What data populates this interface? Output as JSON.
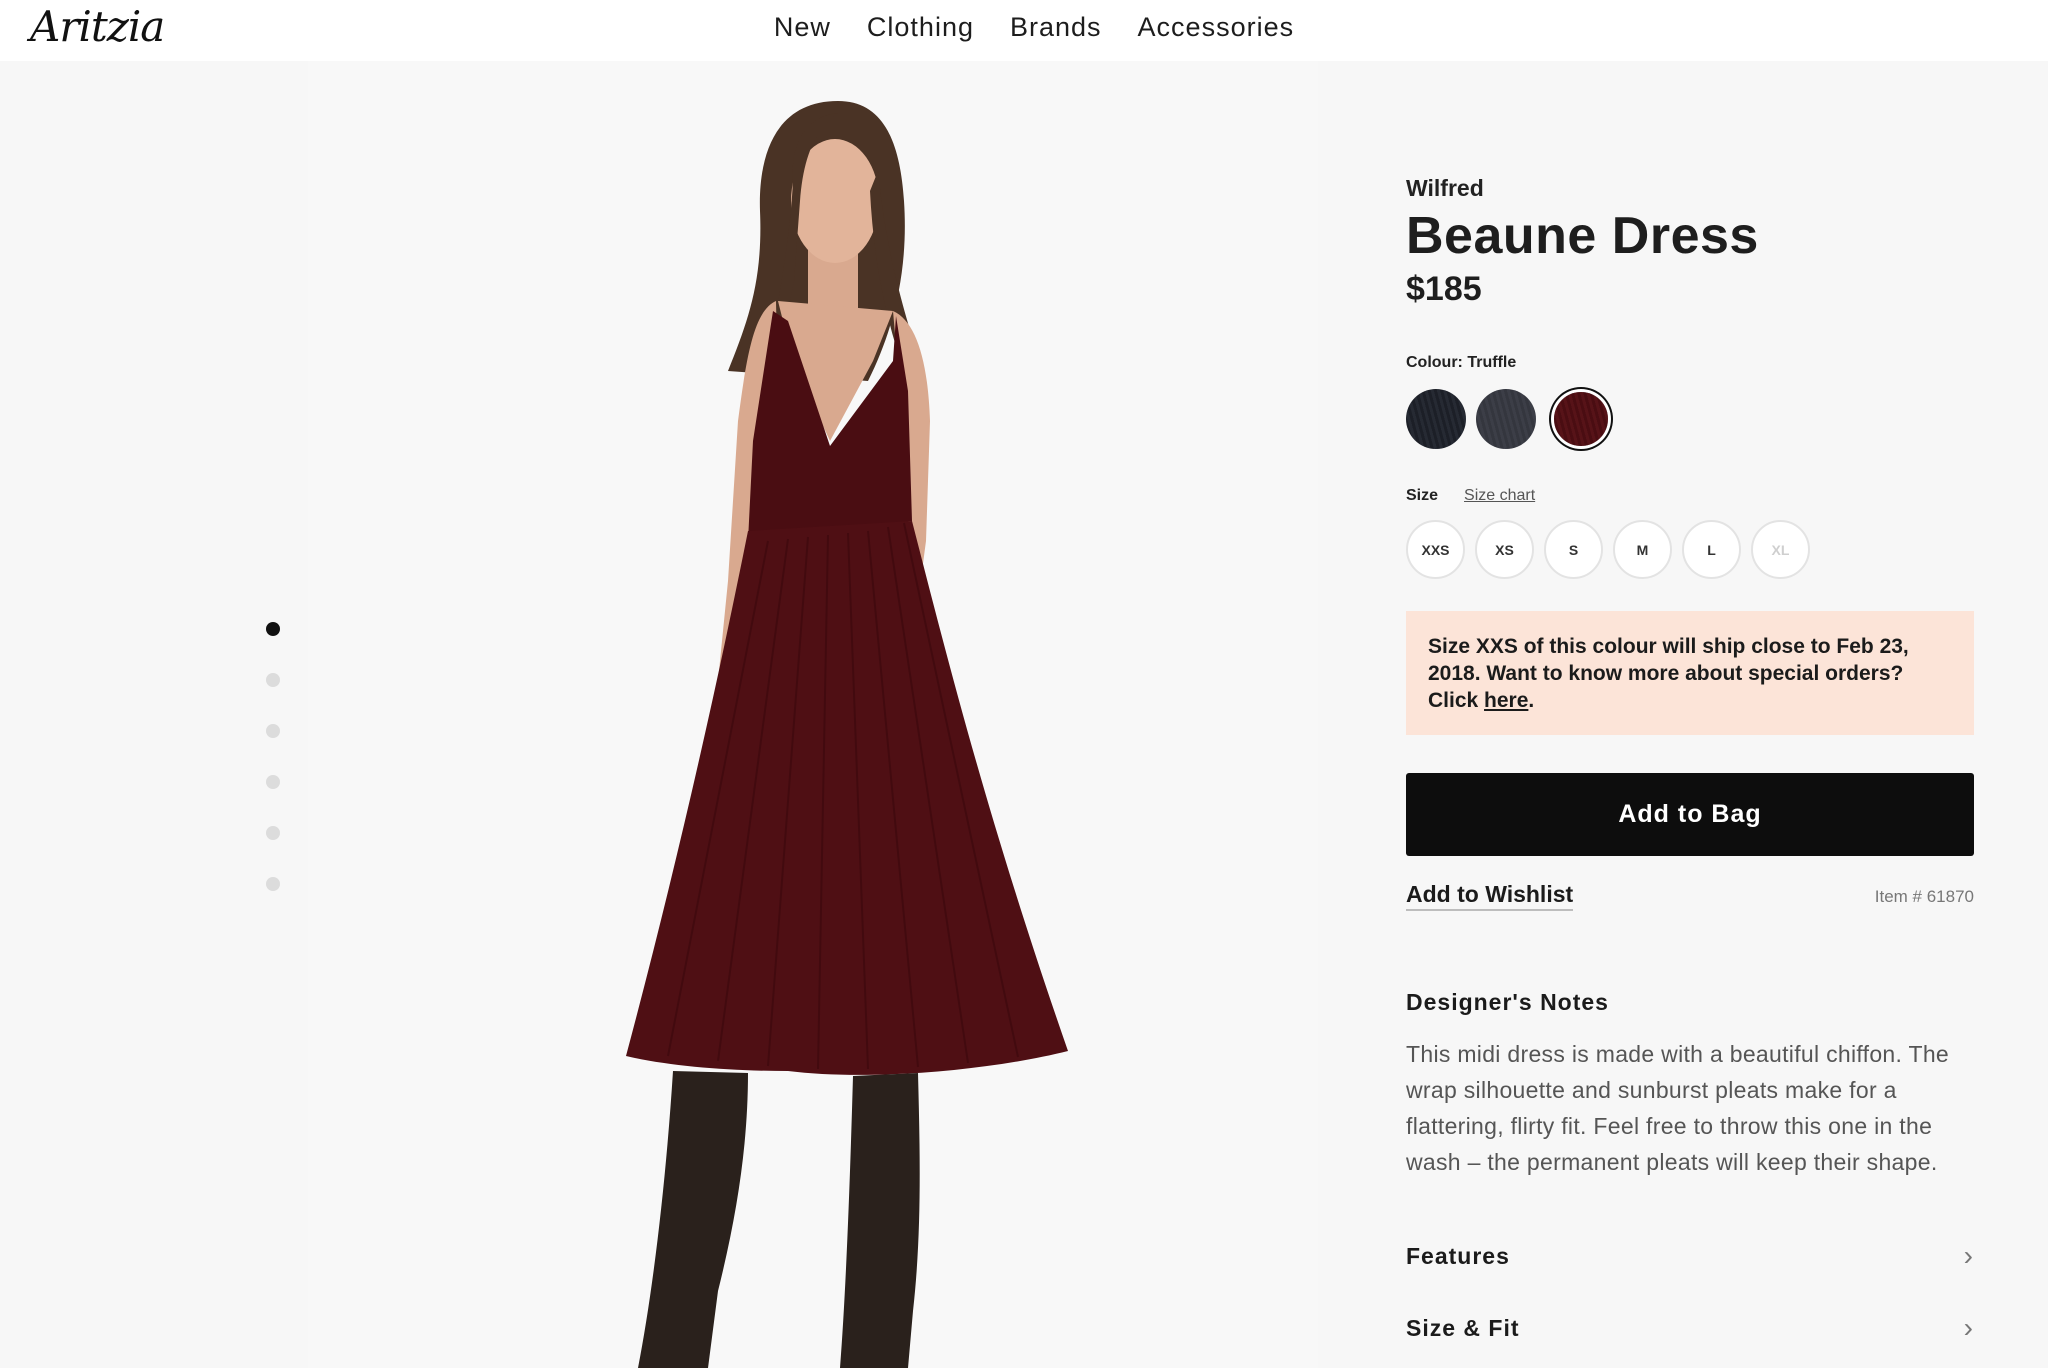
{
  "header": {
    "logo": "Aritzia",
    "nav": [
      "New",
      "Clothing",
      "Brands",
      "Accessories"
    ]
  },
  "gallery": {
    "dot_count": 6,
    "active_index": 0
  },
  "product": {
    "brand": "Wilfred",
    "name": "Beaune Dress",
    "price": "$185",
    "colour_label": "Colour: Truffle",
    "swatches": [
      "black",
      "charcoal",
      "truffle"
    ],
    "selected_swatch": "truffle",
    "size_label": "Size",
    "size_chart": "Size chart",
    "sizes": [
      "XXS",
      "XS",
      "S",
      "M",
      "L",
      "XL"
    ],
    "unavailable_sizes": [
      "XL"
    ],
    "notice_text": "Size XXS of this colour will ship close to Feb 23, 2018. Want to know more about special orders? Click ",
    "notice_link": "here",
    "notice_end": ".",
    "add_to_bag": "Add to Bag",
    "add_to_wishlist": "Add to Wishlist",
    "item_number": "Item # 61870",
    "notes_title": "Designer's Notes",
    "notes_body": "This midi dress is made with a beautiful chiffon. The wrap silhouette and sunburst pleats make for a flattering, flirty fit. Feel free to throw this one in the wash – the permanent pleats will keep their shape.",
    "features": "Features",
    "size_fit": "Size & Fit"
  },
  "colors": {
    "accent": "#0d0d0d",
    "notice_bg": "#fce4d8",
    "dress": "#4a0d12"
  }
}
